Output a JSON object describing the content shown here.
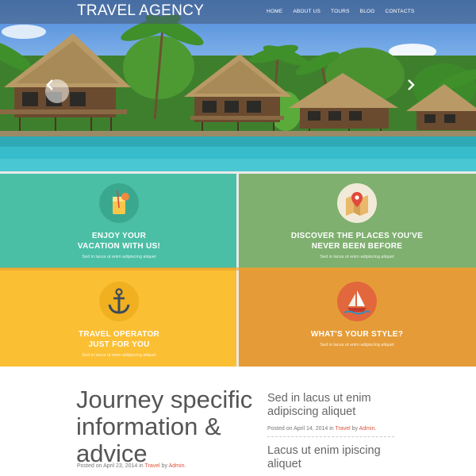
{
  "header": {
    "logo": "TRAVEL AGENCY",
    "nav": [
      "HOME",
      "ABOUT US",
      "TOURS",
      "BLOG",
      "CONTACTS"
    ]
  },
  "slider": {
    "prev_icon": "chevron-left-icon",
    "next_icon": "chevron-right-icon"
  },
  "features": [
    {
      "title_line1": "ENJOY YOUR",
      "title_line2": "VACATION WITH US!",
      "text": "Sed in lacus ut enim adipiscing aliquet",
      "color": "#4bbfa6",
      "icon": "cocktail-icon"
    },
    {
      "title_line1": "DISCOVER THE PLACES YOU'VE",
      "title_line2": "NEVER BEEN BEFORE",
      "text": "Sed in lacus ut enim adipiscing aliquet",
      "color": "#7fb070",
      "icon": "map-pin-icon"
    },
    {
      "title_line1": "TRAVEL OPERATOR",
      "title_line2": "JUST FOR YOU",
      "text": "Sed in lacus ut enim adipiscing aliquet",
      "color": "#fbbf33",
      "icon": "anchor-icon"
    },
    {
      "title_line1": "WHAT'S YOUR STYLE?",
      "title_line2": "",
      "text": "Sed in lacus ut enim adipiscing aliquet",
      "color": "#e59c38",
      "icon": "sailboat-icon"
    }
  ],
  "main_article": {
    "title": "Journey specific information & advice",
    "posted_prefix": "Posted on April 23, 2014 in",
    "category": "Travel",
    "by": "by",
    "author": "Admin."
  },
  "posts": [
    {
      "title": "Sed in lacus ut enim adipiscing aliquet",
      "posted_prefix": "Posted on April 14, 2014 in",
      "category": "Travel",
      "by": "by",
      "author": "Admin."
    },
    {
      "title": "Lacus ut enim ipiscing aliquet"
    }
  ]
}
